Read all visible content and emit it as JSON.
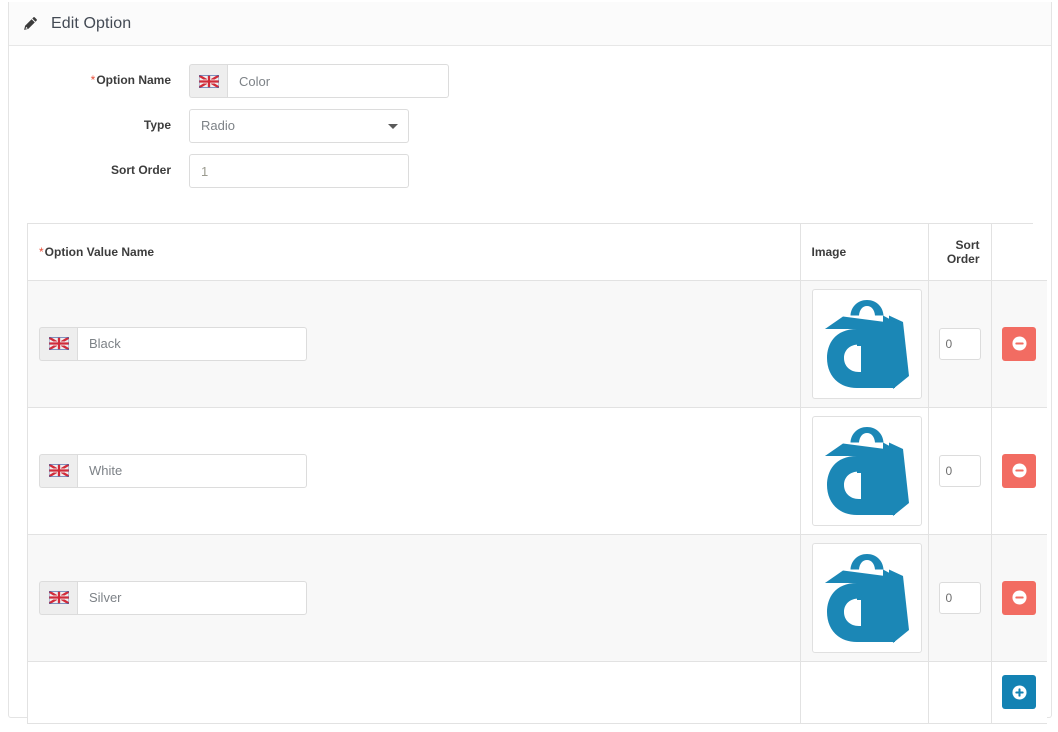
{
  "panel": {
    "icon": "pencil-icon",
    "title": "Edit Option"
  },
  "form": {
    "option_name": {
      "label": "Option Name",
      "required": true,
      "required_marker": "*",
      "flag_icon": "uk-flag-icon",
      "value": "Color",
      "placeholder": "Color"
    },
    "type": {
      "label": "Type",
      "selected": "Radio",
      "caret_icon": "chevron-down-icon"
    },
    "sort_order": {
      "label": "Sort Order",
      "value": "1"
    }
  },
  "table": {
    "headers": {
      "name": "Option Value Name",
      "name_required_marker": "*",
      "image": "Image",
      "sort_order": "Sort Order",
      "actions": ""
    },
    "rows": [
      {
        "flag_icon": "uk-flag-icon",
        "name": "Black",
        "image_alt": "abantecart-bag-logo",
        "sort_order": "0",
        "remove_icon": "minus-circle-icon"
      },
      {
        "flag_icon": "uk-flag-icon",
        "name": "White",
        "image_alt": "abantecart-bag-logo",
        "sort_order": "0",
        "remove_icon": "minus-circle-icon"
      },
      {
        "flag_icon": "uk-flag-icon",
        "name": "Silver",
        "image_alt": "abantecart-bag-logo",
        "sort_order": "0",
        "remove_icon": "minus-circle-icon"
      }
    ],
    "add_row": {
      "add_icon": "plus-circle-icon"
    }
  },
  "colors": {
    "accent_blue": "#1382b3",
    "remove_red": "#f26c62",
    "required_star": "#e8503a",
    "row_stripe": "#f8f8f8",
    "border": "#e2e2e2",
    "text": "#3c3c3c",
    "input_text": "#7d8287"
  }
}
